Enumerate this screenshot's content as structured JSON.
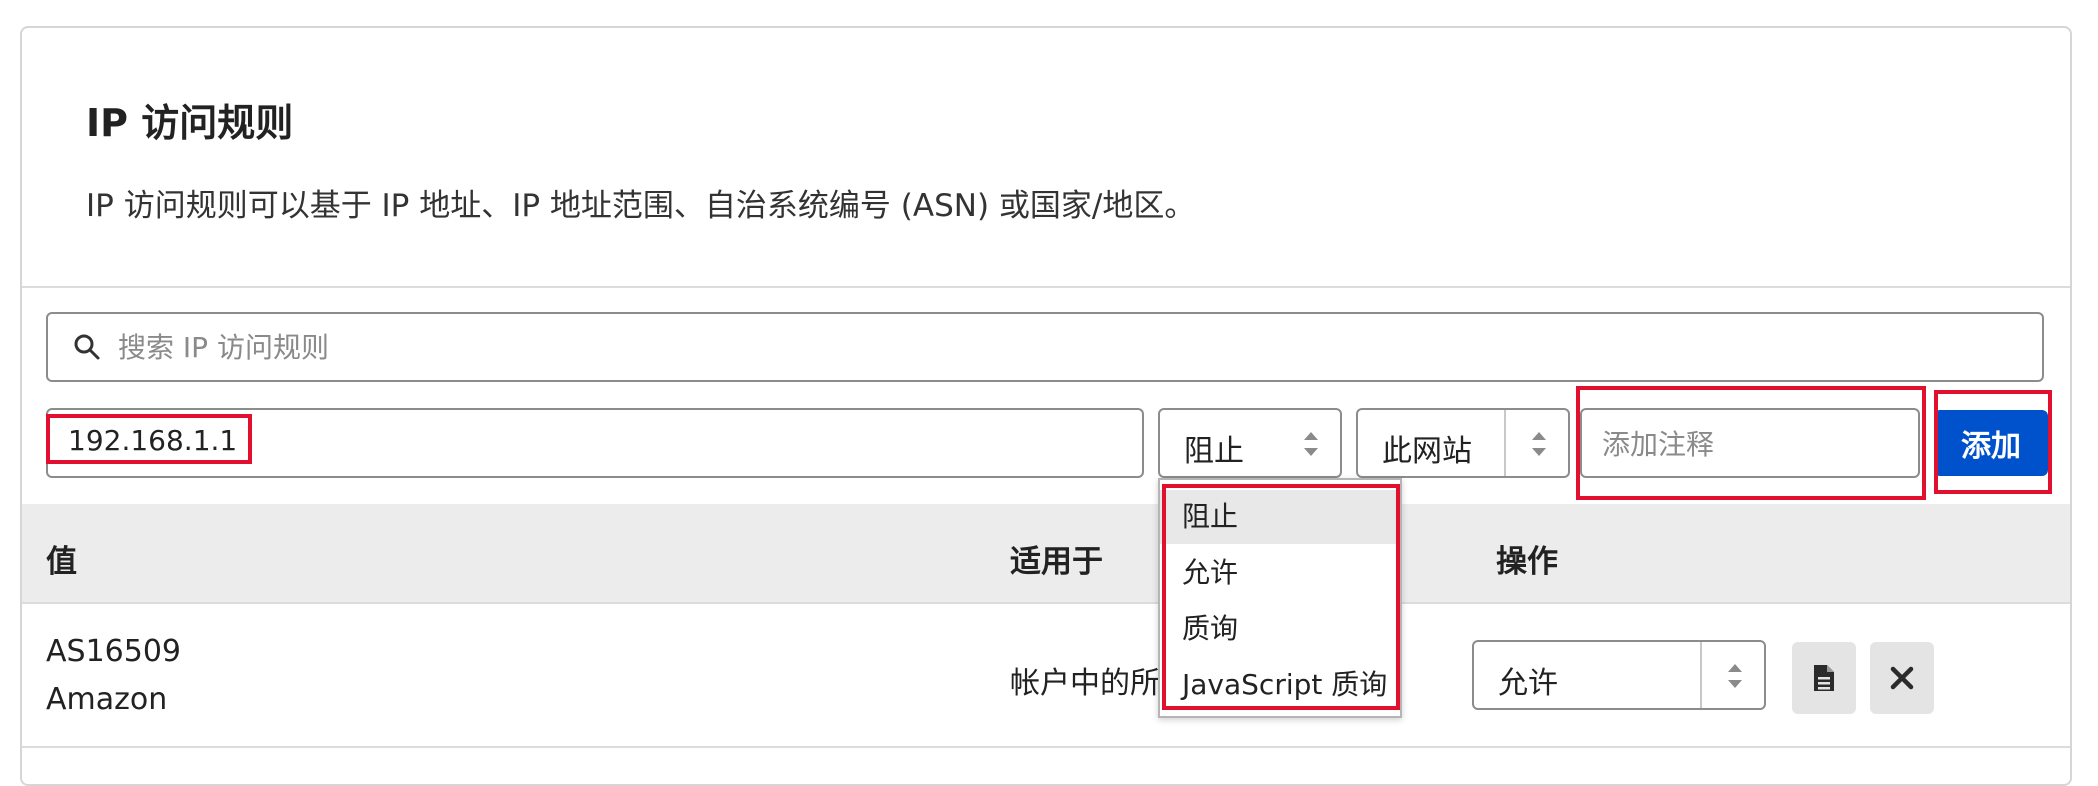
{
  "section": {
    "title": "IP 访问规则",
    "description": "IP 访问规则可以基于 IP 地址、IP 地址范围、自治系统编号 (ASN) 或国家/地区。"
  },
  "search": {
    "placeholder": "搜索 IP 访问规则",
    "icon": "search-icon"
  },
  "form": {
    "ip_value": "192.168.1.1",
    "action_select": "阻止",
    "scope_select": "此网站",
    "note_placeholder": "添加注释",
    "add_button": "添加"
  },
  "action_dropdown": {
    "options": [
      "阻止",
      "允许",
      "质询",
      "JavaScript 质询"
    ],
    "selected": "阻止"
  },
  "table": {
    "headers": {
      "value": "值",
      "applies_to": "适用于",
      "actions": "操作"
    },
    "rows": [
      {
        "value_line1": "AS16509",
        "value_line2": "Amazon",
        "applies_to": "帐户中的所",
        "action": "允许"
      }
    ]
  },
  "colors": {
    "accent": "#0052cc",
    "highlight": "#e0102e",
    "header_bg": "#ececec"
  }
}
